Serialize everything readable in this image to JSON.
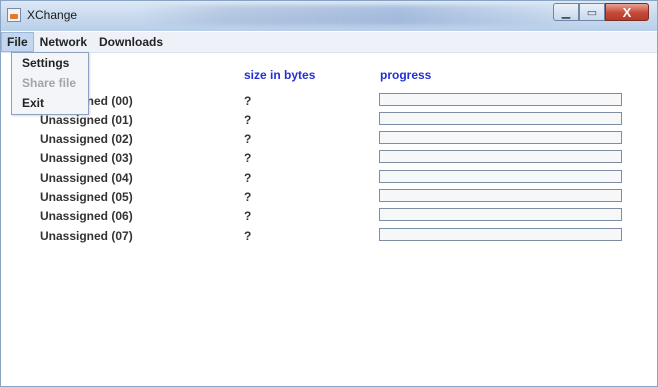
{
  "window": {
    "title": "XChange",
    "icon": "java-cup-icon",
    "minimize_glyph": "▁",
    "maximize_glyph": "▭",
    "close_glyph": "X"
  },
  "menubar": {
    "items": [
      "File",
      "Network",
      "Downloads"
    ],
    "active": "File"
  },
  "file_menu": {
    "items": [
      {
        "label": "Settings",
        "enabled": true
      },
      {
        "label": "Share file",
        "enabled": false
      },
      {
        "label": "Exit",
        "enabled": true
      }
    ]
  },
  "table": {
    "headers": {
      "size": "size in bytes",
      "progress": "progress"
    },
    "header_color": "#2530d4",
    "rows": [
      {
        "name": "Unassigned (00)",
        "size": "?",
        "progress": 0
      },
      {
        "name": "Unassigned (01)",
        "size": "?",
        "progress": 0
      },
      {
        "name": "Unassigned (02)",
        "size": "?",
        "progress": 0
      },
      {
        "name": "Unassigned (03)",
        "size": "?",
        "progress": 0
      },
      {
        "name": "Unassigned (04)",
        "size": "?",
        "progress": 0
      },
      {
        "name": "Unassigned (05)",
        "size": "?",
        "progress": 0
      },
      {
        "name": "Unassigned (06)",
        "size": "?",
        "progress": 0
      },
      {
        "name": "Unassigned (07)",
        "size": "?",
        "progress": 0
      }
    ]
  }
}
